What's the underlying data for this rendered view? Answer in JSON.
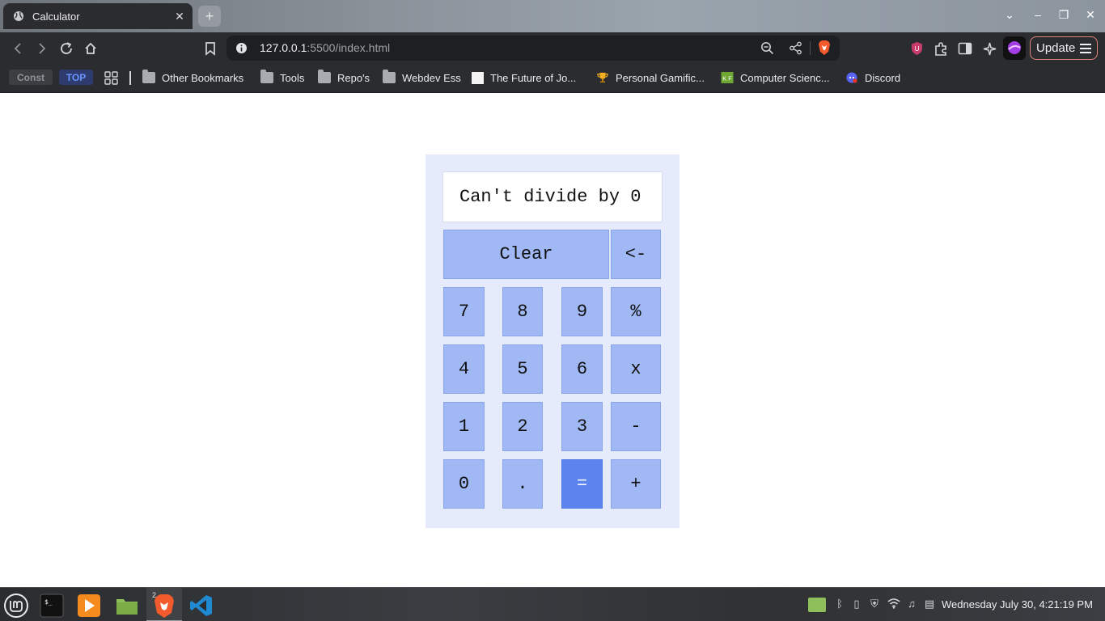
{
  "browser": {
    "tab": {
      "title": "Calculator"
    },
    "window_controls": [
      "chevron-down",
      "minimize",
      "restore",
      "close"
    ],
    "url": {
      "host": "127.0.0.1",
      "rest": ":5500/index.html"
    },
    "update_label": "Update",
    "bookmarks": {
      "pills": [
        {
          "label": "Const",
          "bg": "#3c3e42",
          "fg": "#8f9297"
        },
        {
          "label": "TOP",
          "bg": "#2d3b6e",
          "fg": "#6b95ff"
        }
      ],
      "items": [
        {
          "label": "Other Bookmarks",
          "icon": "folder-icon"
        },
        {
          "label": "Tools",
          "icon": "folder-icon"
        },
        {
          "label": "Repo's",
          "icon": "folder-icon"
        },
        {
          "label": "Webdev Ess",
          "icon": "folder-icon"
        },
        {
          "label": "The Future of Jo...",
          "icon": "document-icon"
        },
        {
          "label": "Personal Gamific...",
          "icon": "trophy-icon"
        },
        {
          "label": "Computer Scienc...",
          "icon": "kf-icon"
        },
        {
          "label": "Discord",
          "icon": "discord-icon"
        }
      ]
    }
  },
  "calculator": {
    "display": "Can't divide by 0",
    "keys": {
      "clear": "Clear",
      "backspace": "<-",
      "seven": "7",
      "eight": "8",
      "nine": "9",
      "percent": "%",
      "four": "4",
      "five": "5",
      "six": "6",
      "multiply": "x",
      "one": "1",
      "two": "2",
      "three": "3",
      "minus": "-",
      "zero": "0",
      "dot": ".",
      "equals": "=",
      "plus": "+"
    },
    "colors": {
      "panel": "#e6ebfc",
      "key": "#a0b8f4",
      "equals": "#5b84ee"
    }
  },
  "taskbar": {
    "apps": [
      "mint-menu-icon",
      "terminal-icon",
      "media-player-icon",
      "files-icon",
      "brave-icon",
      "vscode-icon"
    ],
    "brave_badge": "2",
    "clock": "Wednesday July 30, 4:21:19 PM"
  }
}
